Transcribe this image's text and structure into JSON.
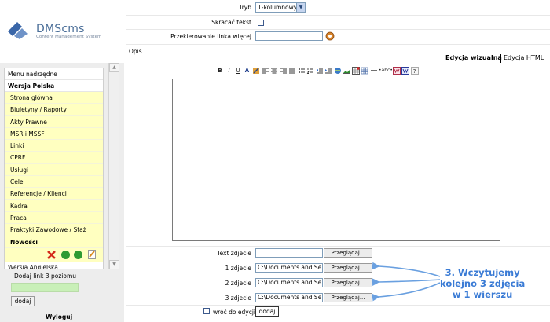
{
  "logo": {
    "title": "DMScms",
    "subtitle": "Content Management System"
  },
  "sidebar": {
    "menu_header": "Menu nadrzędne",
    "section_title": "Wersja Polska",
    "items": [
      "Strona główna",
      "Biuletyny / Raporty",
      "Akty Prawne",
      "MSR i MSSF",
      "Linki",
      "CPRF",
      "Usługi",
      "Cele",
      "Referencje / Klienci",
      "Kadra",
      "Praca",
      "Praktyki Zawodowe / Staż"
    ],
    "selected_item": "Nowości",
    "next_section": "Wersja Angielska",
    "add_label": "Dodaj link 3 poziomu",
    "add_button": "dodaj",
    "logout": "Wyloguj"
  },
  "form": {
    "mode_label": "Tryb",
    "mode_value": "1-kolumnowy",
    "shorten_label": "Skracać tekst",
    "redirect_label": "Przekierowanie linka więcej",
    "description_label": "Opis",
    "tab_visual": "Edycja wizualna",
    "tab_html": "Edycja HTML",
    "text_photo_label": "Text zdjecie",
    "photos": [
      {
        "label": "1 zdjecie",
        "value": "C:\\Documents and Se"
      },
      {
        "label": "2 zdjecie",
        "value": "C:\\Documents and Se"
      },
      {
        "label": "3 zdjecie",
        "value": "C:\\Documents and Se"
      }
    ],
    "browse_label": "Przeglądaj...",
    "return_label": "wróć do edycji",
    "return_button": "dodaj"
  },
  "toolbar": {
    "bold": "B",
    "italic": "I",
    "underline": "U",
    "font_color": "A",
    "abbr": "abc",
    "help": "?"
  },
  "annotation": {
    "line1": "3. Wczytujemy",
    "line2": "kolejno 3 zdjęcia",
    "line3": "w 1 wierszu"
  },
  "colors": {
    "menu_highlight": "#ffffc0",
    "annotation": "#3a7bd5",
    "add_input": "#c9f0b8"
  }
}
